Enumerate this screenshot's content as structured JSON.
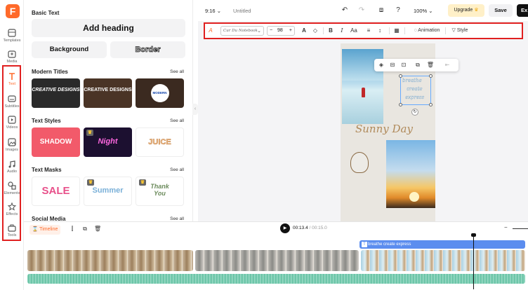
{
  "app": {
    "logo_letter": "F",
    "accent": "#ff6a2a",
    "highlight": "#e02020"
  },
  "rail": {
    "items": [
      {
        "label": "Templates",
        "icon": "templates-icon"
      },
      {
        "label": "Media",
        "icon": "media-icon"
      },
      {
        "label": "Text",
        "icon": "text-icon",
        "active": true
      },
      {
        "label": "Subtitles",
        "icon": "subtitles-icon"
      },
      {
        "label": "Videos",
        "icon": "videos-icon"
      },
      {
        "label": "Images",
        "icon": "images-icon"
      },
      {
        "label": "Audio",
        "icon": "audio-icon"
      },
      {
        "label": "Elements",
        "icon": "elements-icon"
      },
      {
        "label": "Effects",
        "icon": "effects-icon"
      },
      {
        "label": "Tools",
        "icon": "tools-icon"
      }
    ]
  },
  "panel": {
    "basic_title": "Basic Text",
    "add_heading": "Add heading",
    "background_label": "Background",
    "border_label": "Border",
    "see_all": "See all",
    "modern_titles": {
      "title": "Modern Titles",
      "cards": [
        "CREATIVE DESIGNS",
        "CREATIVE DESIGNS",
        "MODERN DESIGNS"
      ]
    },
    "text_styles": {
      "title": "Text Styles",
      "cards": [
        "SHADOW",
        "Night",
        "JUICE"
      ]
    },
    "text_masks": {
      "title": "Text Masks",
      "cards": [
        "SALE",
        "Summer",
        "Thank You"
      ]
    },
    "social_media": {
      "title": "Social Media"
    }
  },
  "topbar": {
    "ratio": "9:16",
    "title": "Untitled",
    "zoom": "100%",
    "upgrade": "Upgrade",
    "save": "Save",
    "export": "Ex"
  },
  "toolbar": {
    "font_name": "Cur Du Notebook",
    "font_size": "98",
    "animation": "Animation",
    "style": "Style"
  },
  "canvas": {
    "selected_text": [
      "breathe",
      "create",
      "express"
    ],
    "sunny": "Sunny Day"
  },
  "timeline": {
    "label": "Timeline",
    "current_time": "00:13.4",
    "total_time": "/ 00:15.0",
    "text_track": "breathe  create  express"
  }
}
